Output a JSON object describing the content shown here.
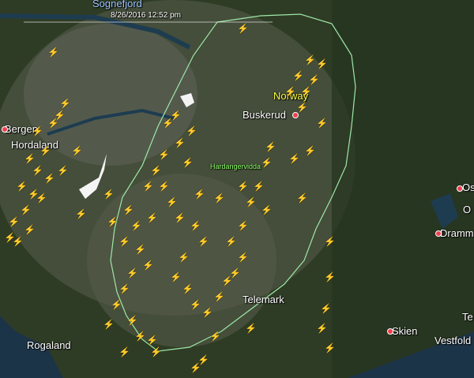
{
  "timestamp": "8/26/2016 12:52 pm",
  "colors": {
    "lightning_yellow": "#f5c400",
    "lightning_magenta": "#e23cff",
    "outline": "#9ee8a8"
  },
  "places": {
    "sognefjord": "Sognefjord",
    "bergen": "Bergen",
    "hordaland": "Hordaland",
    "norway": "Norway",
    "buskerud": "Buskerud",
    "hardangervidda": "Hardangervidda",
    "telemark": "Telemark",
    "rogaland": "Rogaland",
    "skien": "Skien",
    "drammen": "Drammen",
    "vestfold": "Vestfold",
    "oslo_partial": "Os",
    "te_partial": "Te",
    "o_partial": "O"
  }
}
